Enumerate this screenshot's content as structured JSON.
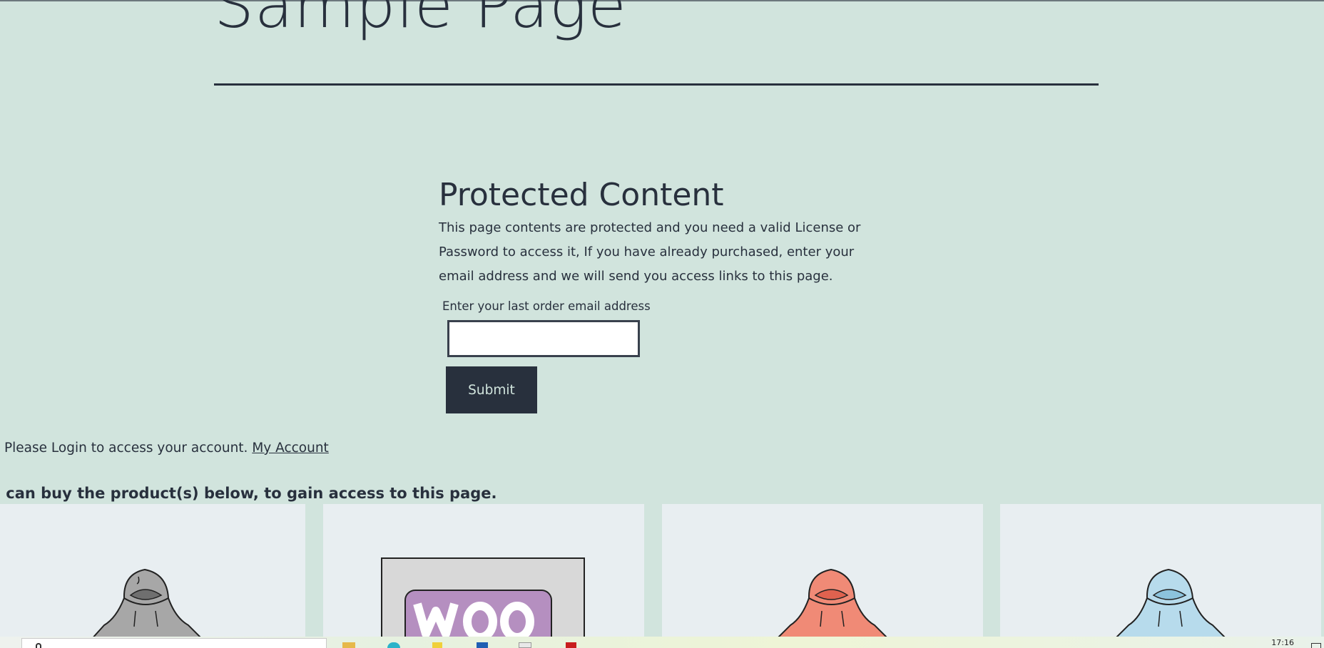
{
  "page": {
    "title": "Sample Page"
  },
  "protected": {
    "heading": "Protected Content",
    "body": "This page contents are protected and you need a valid License or Password to access it, If you have already purchased, enter your email address and we will send you access links to this page.",
    "email_label": "Enter your last order email address",
    "email_value": "",
    "submit_label": "Submit"
  },
  "login": {
    "text": "Please Login to access your account.",
    "link_label": "My Account"
  },
  "buy": {
    "text": "u can buy the product(s) below, to gain access to this page."
  },
  "products": [
    {
      "image": "grey-hoodie-illustration",
      "color": "#9a9a9a"
    },
    {
      "image": "woo-logo-sign-illustration",
      "color": "#b58fc0"
    },
    {
      "image": "red-hoodie-illustration",
      "color": "#f08a76"
    },
    {
      "image": "blue-hoodie-illustration",
      "color": "#a9d2e6"
    }
  ],
  "taskbar": {
    "clock": "17:16",
    "icons": [
      "search-icon",
      "file-explorer-icon",
      "edge-browser-icon",
      "sticky-notes-icon",
      "app-icon",
      "notepad-icon",
      "pdf-icon"
    ]
  }
}
